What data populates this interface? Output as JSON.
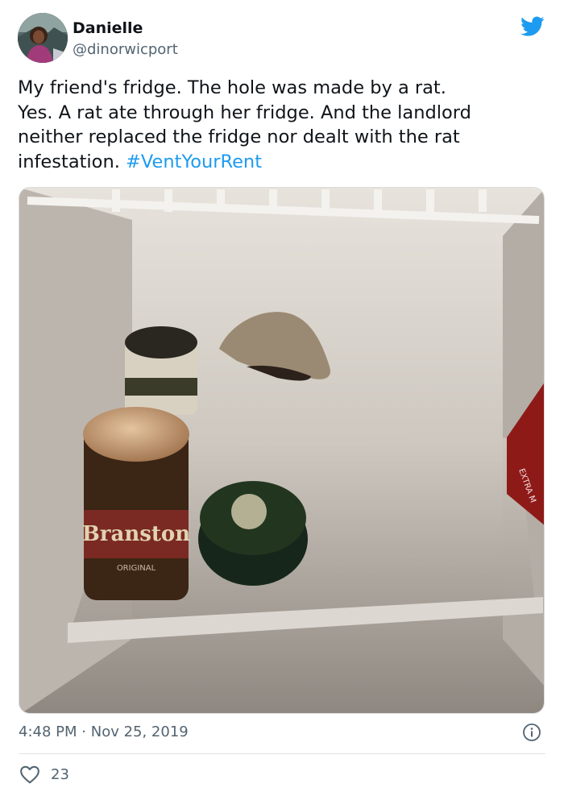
{
  "author": {
    "name": "Danielle",
    "handle": "@dinorwicport"
  },
  "tweet": {
    "lines": [
      "My friend's fridge. The hole was made by a rat.",
      "Yes. A rat ate through her fridge. And the landlord",
      "neither replaced the fridge nor dealt with the rat"
    ],
    "last_line": "infestation.",
    "hashtag": "#VentYourRent"
  },
  "photo": {
    "jar_label": "Branston",
    "jar_sub": "ORIGINAL",
    "box_label": "EXTRA M"
  },
  "meta": {
    "time": "4:48 PM",
    "separator": "·",
    "date": "Nov 25, 2019"
  },
  "engagement": {
    "likes": "23"
  },
  "colors": {
    "accent": "#1d9bf0",
    "text": "#0f1419",
    "muted": "#536471"
  }
}
